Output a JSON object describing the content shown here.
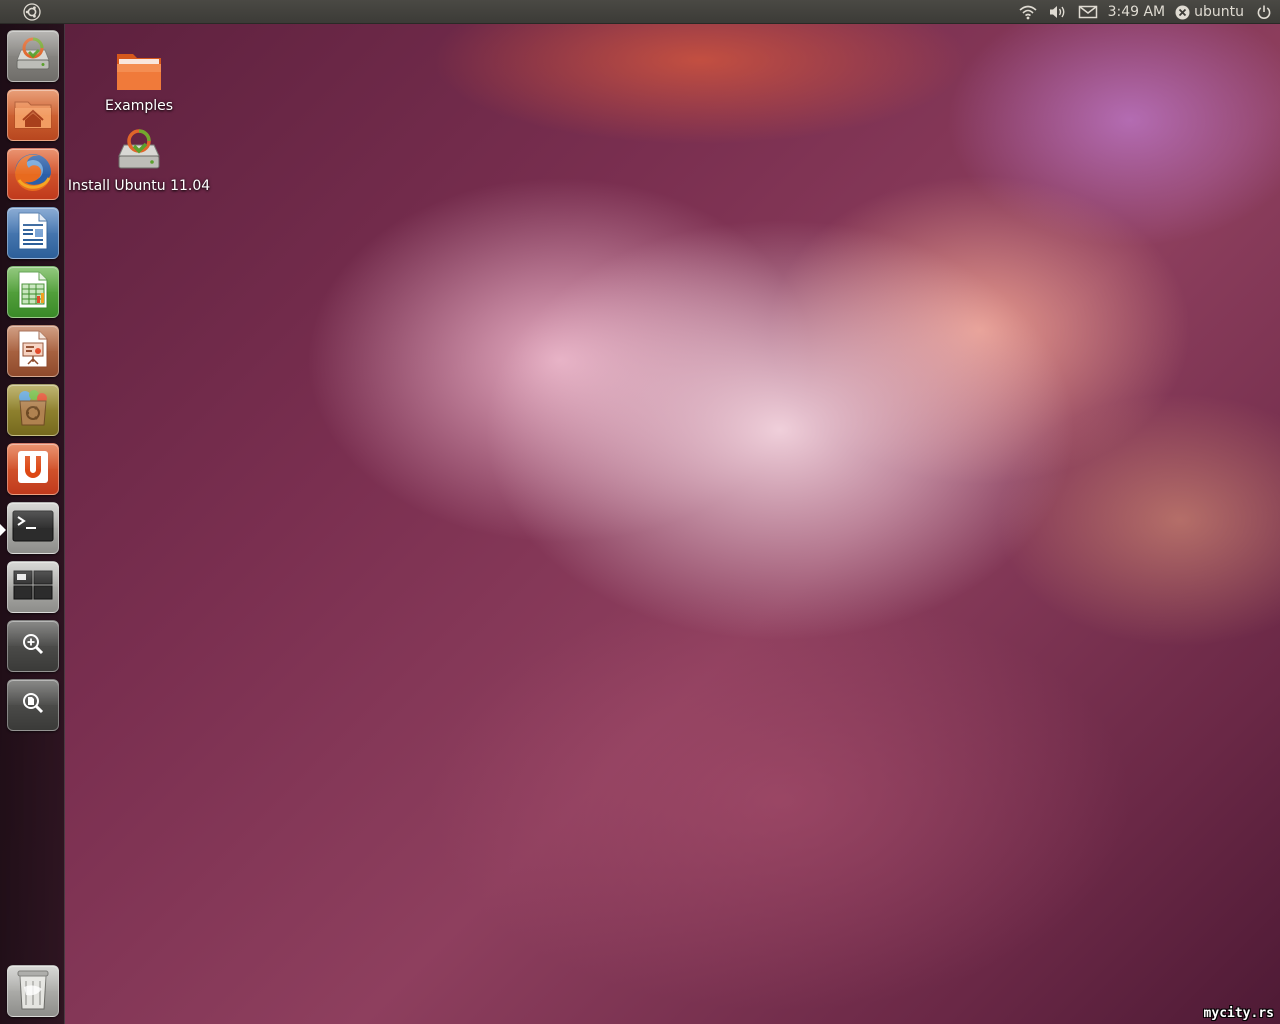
{
  "top_panel": {
    "clock": "3:49 AM",
    "username": "ubuntu",
    "icons": [
      "ubuntu-logo-icon",
      "wifi-icon",
      "volume-icon",
      "mail-icon",
      "user-icon",
      "power-icon"
    ]
  },
  "launcher": {
    "items": [
      {
        "name": "install-ubuntu",
        "icon": "installer-icon"
      },
      {
        "name": "home-folder",
        "icon": "home-folder-icon"
      },
      {
        "name": "firefox",
        "icon": "firefox-icon"
      },
      {
        "name": "libreoffice-writer",
        "icon": "writer-document-icon"
      },
      {
        "name": "libreoffice-calc",
        "icon": "spreadsheet-icon"
      },
      {
        "name": "libreoffice-impress",
        "icon": "presentation-icon"
      },
      {
        "name": "software-center",
        "icon": "shopping-bag-icon"
      },
      {
        "name": "ubuntu-one",
        "icon": "ubuntu-one-icon"
      },
      {
        "name": "terminal",
        "icon": "terminal-icon"
      },
      {
        "name": "workspace-switcher",
        "icon": "workspaces-icon"
      },
      {
        "name": "applications-lens",
        "icon": "magnifier-plus-icon"
      },
      {
        "name": "files-lens",
        "icon": "magnifier-file-icon"
      },
      {
        "name": "trash",
        "icon": "trash-icon"
      }
    ]
  },
  "desktop": {
    "icons": [
      {
        "label": "Examples",
        "icon": "folder-icon"
      },
      {
        "label": "Install Ubuntu 11.04",
        "icon": "installer-icon"
      }
    ]
  },
  "watermark": "mycity.rs",
  "colors": {
    "panel": "#3c3b37",
    "panel_text": "#dfdbd2",
    "accent_orange": "#e07a45"
  }
}
